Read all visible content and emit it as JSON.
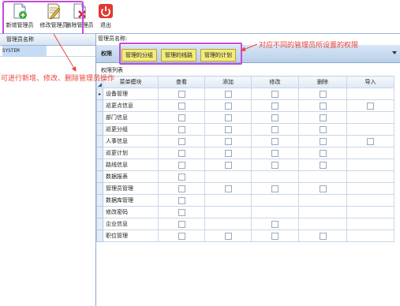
{
  "toolbar": {
    "buttons": [
      {
        "label": "新增管理员",
        "icon": "add-document-icon"
      },
      {
        "label": "修改管理员",
        "icon": "edit-document-icon"
      },
      {
        "label": "删除管理员",
        "icon": "delete-document-icon"
      },
      {
        "label": "退出",
        "icon": "power-icon"
      }
    ]
  },
  "left_panel": {
    "header": "管理员名称",
    "rows": [
      "SYSTEM"
    ]
  },
  "right_panel": {
    "title": "管理员名称:",
    "tab_label": "权限",
    "tabs": [
      "管理的分组",
      "管理的线路",
      "管理的计划"
    ],
    "list_label": "权限列表"
  },
  "grid": {
    "columns": [
      "菜单模块",
      "查看",
      "添加",
      "修改",
      "删除",
      "导入"
    ],
    "row_marker": "▸",
    "rows": [
      {
        "name": "设备管理",
        "cb": [
          1,
          1,
          1,
          1,
          0
        ]
      },
      {
        "name": "巡更点信息",
        "cb": [
          1,
          1,
          1,
          1,
          1
        ]
      },
      {
        "name": "部门信息",
        "cb": [
          1,
          1,
          1,
          1,
          0
        ]
      },
      {
        "name": "巡更分组",
        "cb": [
          1,
          1,
          1,
          1,
          0
        ]
      },
      {
        "name": "人事信息",
        "cb": [
          1,
          1,
          1,
          1,
          1
        ]
      },
      {
        "name": "巡更计划",
        "cb": [
          1,
          1,
          1,
          1,
          0
        ]
      },
      {
        "name": "路线信息",
        "cb": [
          1,
          1,
          1,
          1,
          0
        ]
      },
      {
        "name": "数据报表",
        "cb": [
          1,
          0,
          0,
          0,
          0
        ]
      },
      {
        "name": "管理员管理",
        "cb": [
          1,
          1,
          1,
          1,
          0
        ]
      },
      {
        "name": "数据库管理",
        "cb": [
          1,
          0,
          0,
          0,
          0
        ]
      },
      {
        "name": "修改密码",
        "cb": [
          1,
          0,
          0,
          0,
          0
        ]
      },
      {
        "name": "企业信息",
        "cb": [
          1,
          0,
          1,
          0,
          0
        ]
      },
      {
        "name": "职位管理",
        "cb": [
          1,
          1,
          1,
          1,
          0
        ]
      }
    ]
  },
  "annotations": {
    "tools_note": "可进行新增、修改、删除管理员操作",
    "tabs_note": "对应不同的管理员所设置的权限"
  },
  "colors": {
    "highlight": "#c34bd6",
    "annotation": "#e8453c",
    "tab_bg": "#f4ec7a"
  }
}
